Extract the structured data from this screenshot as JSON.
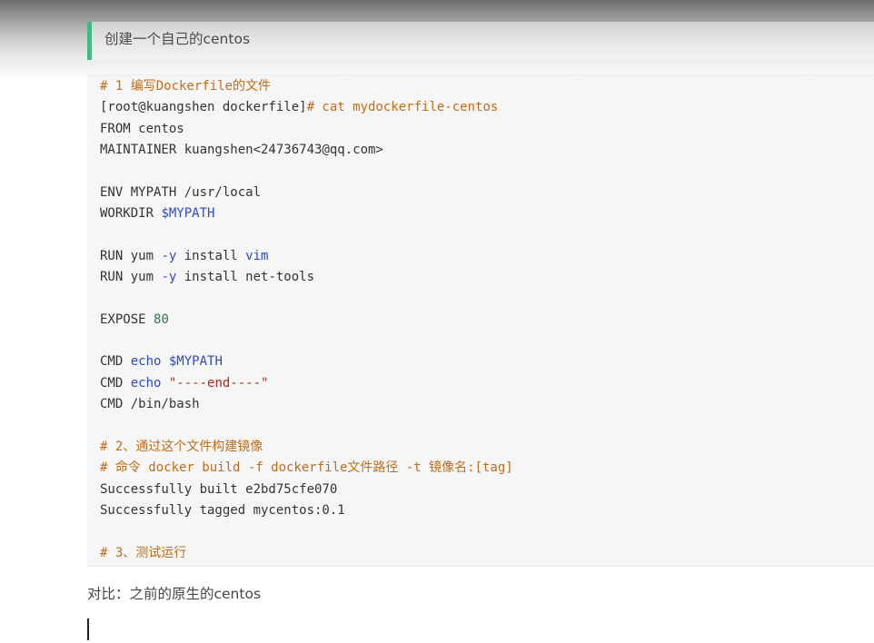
{
  "quote": {
    "text": "创建一个自己的centos"
  },
  "code": {
    "comment1": "# 1 编写Dockerfile的文件",
    "prompt": "[root@kuangshen dockerfile]",
    "cmd_cat": "# cat mydockerfile-centos",
    "from": "FROM centos",
    "maintainer": "MAINTAINER kuangshen<24736743@qq.com>",
    "env": "ENV MYPATH /usr/local",
    "workdir_kw": "WORKDIR ",
    "workdir_var": "$MYPATH",
    "run1_a": "RUN yum ",
    "run1_flag": "-y",
    "run1_b": " install ",
    "run1_pkg": "vim",
    "run2_a": "RUN yum ",
    "run2_flag": "-y",
    "run2_b": " install net-tools",
    "expose_kw": "EXPOSE ",
    "expose_port": "80",
    "cmd1_kw": "CMD ",
    "cmd1_echo": "echo",
    "cmd1_var": " $MYPATH",
    "cmd2_kw": "CMD ",
    "cmd2_echo": "echo",
    "cmd2_str": " \"----end----\"",
    "cmd3": "CMD /bin/bash",
    "comment2": "# 2、通过这个文件构建镜像",
    "comment3": "# 命令 docker build -f dockerfile文件路径 -t 镜像名:[tag]",
    "built": "Successfully built e2bd75cfe070",
    "tagged": "Successfully tagged mycentos:0.1",
    "comment4": "# 3、测试运行"
  },
  "paragraph": {
    "text": "对比：之前的原生的centos"
  },
  "colors": {
    "quote_border": "#42b983",
    "code_bg": "#f6f6f6",
    "comment": "#c16c1a",
    "variable": "#2f49c7",
    "number": "#2c7a4f",
    "string": "#b3261e"
  }
}
